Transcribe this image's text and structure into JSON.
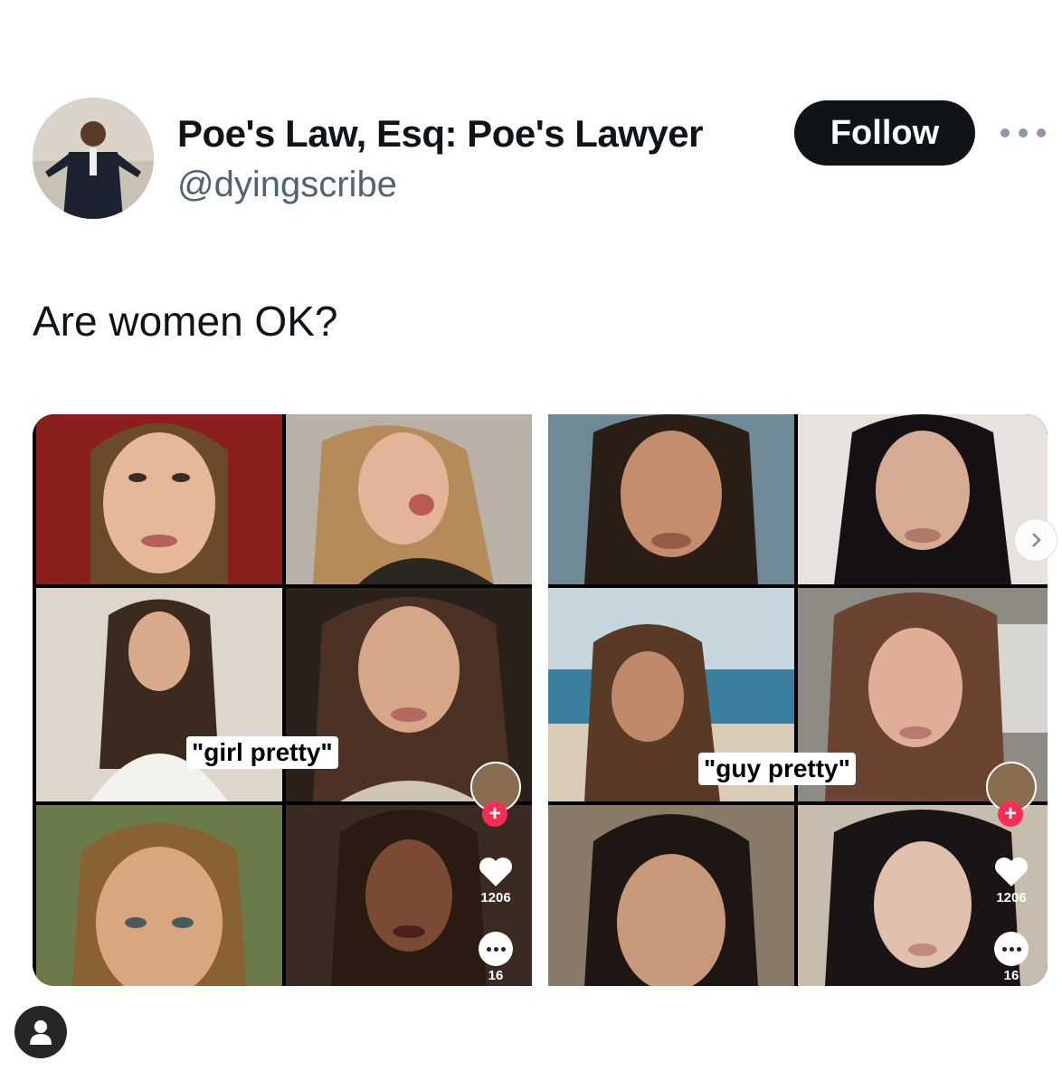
{
  "author": {
    "display_name": "Poe's Law, Esq: Poe's Lawyer",
    "handle": "@dyingscribe"
  },
  "actions": {
    "follow_label": "Follow"
  },
  "tweet": {
    "text": "Are women OK?"
  },
  "media": {
    "left_panel": {
      "caption": "\"girl pretty\"",
      "likes": "1206",
      "comments": "16"
    },
    "right_panel": {
      "caption": "\"guy pretty\"",
      "likes": "1206",
      "comments": "16"
    }
  },
  "colors": {
    "text_primary": "#0f1419",
    "text_secondary": "#536471",
    "follow_bg": "#0f1419",
    "tiktok_plus": "#fe2c55"
  },
  "icons": {
    "more": "more-dots-icon",
    "next": "chevron-right-icon",
    "profile": "user-icon",
    "like": "heart-icon",
    "comment": "comment-icon",
    "plus": "plus-icon"
  }
}
